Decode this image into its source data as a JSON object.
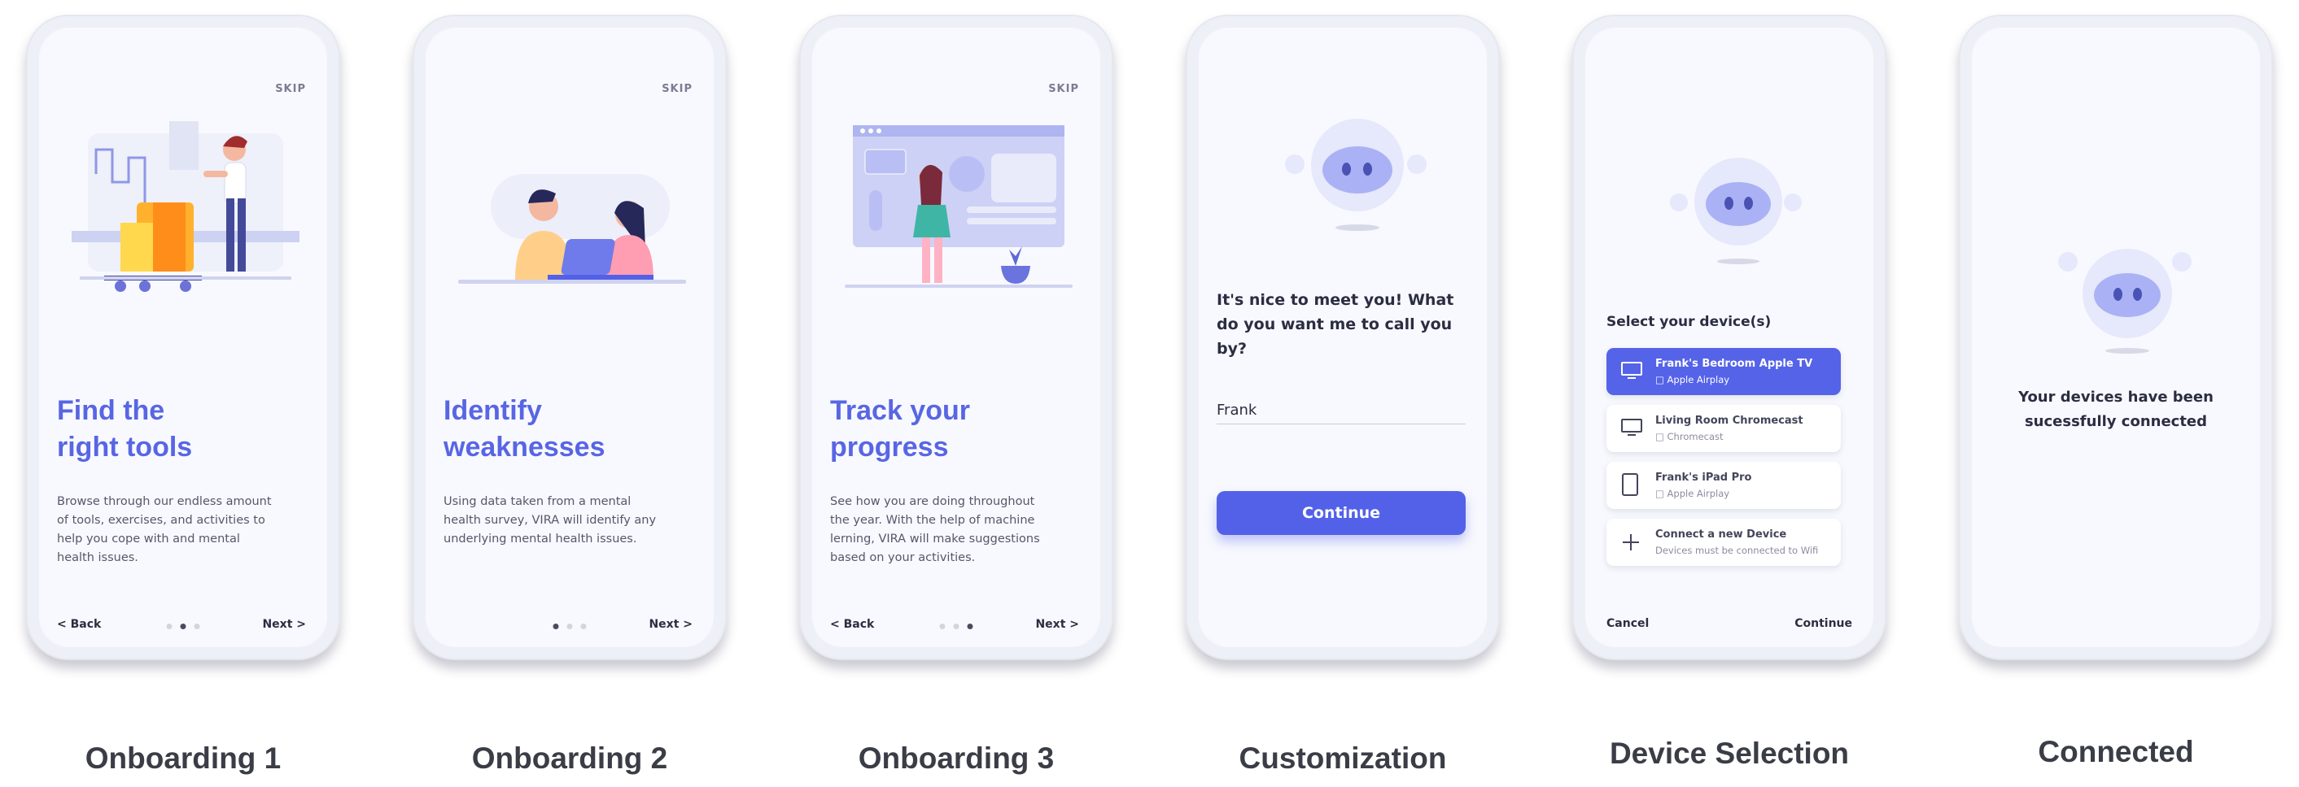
{
  "screens": [
    {
      "caption": "Onboarding 1",
      "skip": "SKIP",
      "heading": "Find the\nright tools",
      "body": "Browse through our endless amount of tools, exercises, and activities to help you cope with and mental health issues.",
      "back": "< Back",
      "next": "Next >",
      "active_dot": 2
    },
    {
      "caption": "Onboarding 2",
      "skip": "SKIP",
      "heading": "Identify\nweaknesses",
      "body": "Using data taken from a mental health survey, VIRA will identify any underlying mental health issues.",
      "next": "Next >",
      "active_dot": 1
    },
    {
      "caption": "Onboarding 3",
      "skip": "SKIP",
      "heading": "Track your\nprogress",
      "body": "See how you are doing throughout the year. With the help of machine lerning, VIRA will make suggestions based on your activities.",
      "back": "< Back",
      "next": "Next >",
      "active_dot": 3
    },
    {
      "caption": "Customization",
      "question": "It's nice to meet you! What do you want me to call you by?",
      "name_value": "Frank",
      "button": "Continue"
    },
    {
      "caption": "Device Selection",
      "title": "Select your device(s)",
      "devices": [
        {
          "name": "Frank's Bedroom Apple TV",
          "sub": "Apple Airplay",
          "icon": "tv-icon",
          "selected": true
        },
        {
          "name": "Living Room Chromecast",
          "sub": "Chromecast",
          "icon": "tv-icon",
          "selected": false
        },
        {
          "name": "Frank's iPad Pro",
          "sub": "Apple Airplay",
          "icon": "tablet-icon",
          "selected": false
        },
        {
          "name": "Connect a new Device",
          "sub": "Devices must be connected to Wifi",
          "icon": "plus-icon",
          "selected": false
        }
      ],
      "cancel": "Cancel",
      "continue": "Continue"
    },
    {
      "caption": "Connected",
      "message": "Your devices have been sucessfully connected"
    }
  ],
  "colors": {
    "accent": "#5361e8",
    "heading": "#5866e4",
    "robot_face": "#aab2f5"
  }
}
